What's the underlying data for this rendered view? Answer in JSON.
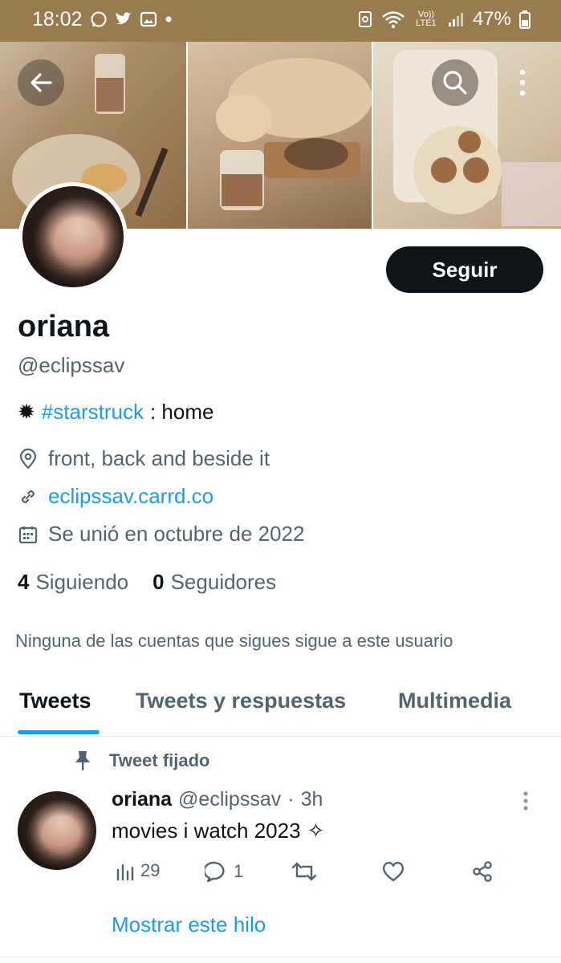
{
  "status_bar": {
    "time": "18:02",
    "network_label": "Vo)) LTE1",
    "battery": "47%"
  },
  "profile": {
    "display_name": "oriana",
    "handle": "@eclipssav",
    "follow_button": "Seguir",
    "bio": {
      "emoji": "✹",
      "hashtag": "#starstruck",
      "text": ": home"
    },
    "location": "front, back and beside it",
    "url": "eclipssav.carrd.co",
    "joined": "Se unió en octubre de 2022",
    "following_count": "4",
    "following_label": "Siguiendo",
    "followers_count": "0",
    "followers_label": "Seguidores",
    "note": "Ninguna de las cuentas que sigues sigue a este usuario"
  },
  "tabs": [
    {
      "label": "Tweets",
      "active": true
    },
    {
      "label": "Tweets y respuestas",
      "active": false
    },
    {
      "label": "Multimedia",
      "active": false
    }
  ],
  "pinned_tweet": {
    "pinned_label": "Tweet fijado",
    "author_name": "oriana",
    "author_handle": "@eclipssav",
    "separator": "·",
    "time": "3h",
    "text": "movies i watch 2023",
    "text_emoji": "✧",
    "views": "29",
    "replies": "1",
    "show_thread": "Mostrar este hilo"
  },
  "colors": {
    "accent": "#1d9bf0",
    "text_primary": "#0f1419",
    "text_secondary": "#536471",
    "status_bar": "#9a7a4f"
  }
}
